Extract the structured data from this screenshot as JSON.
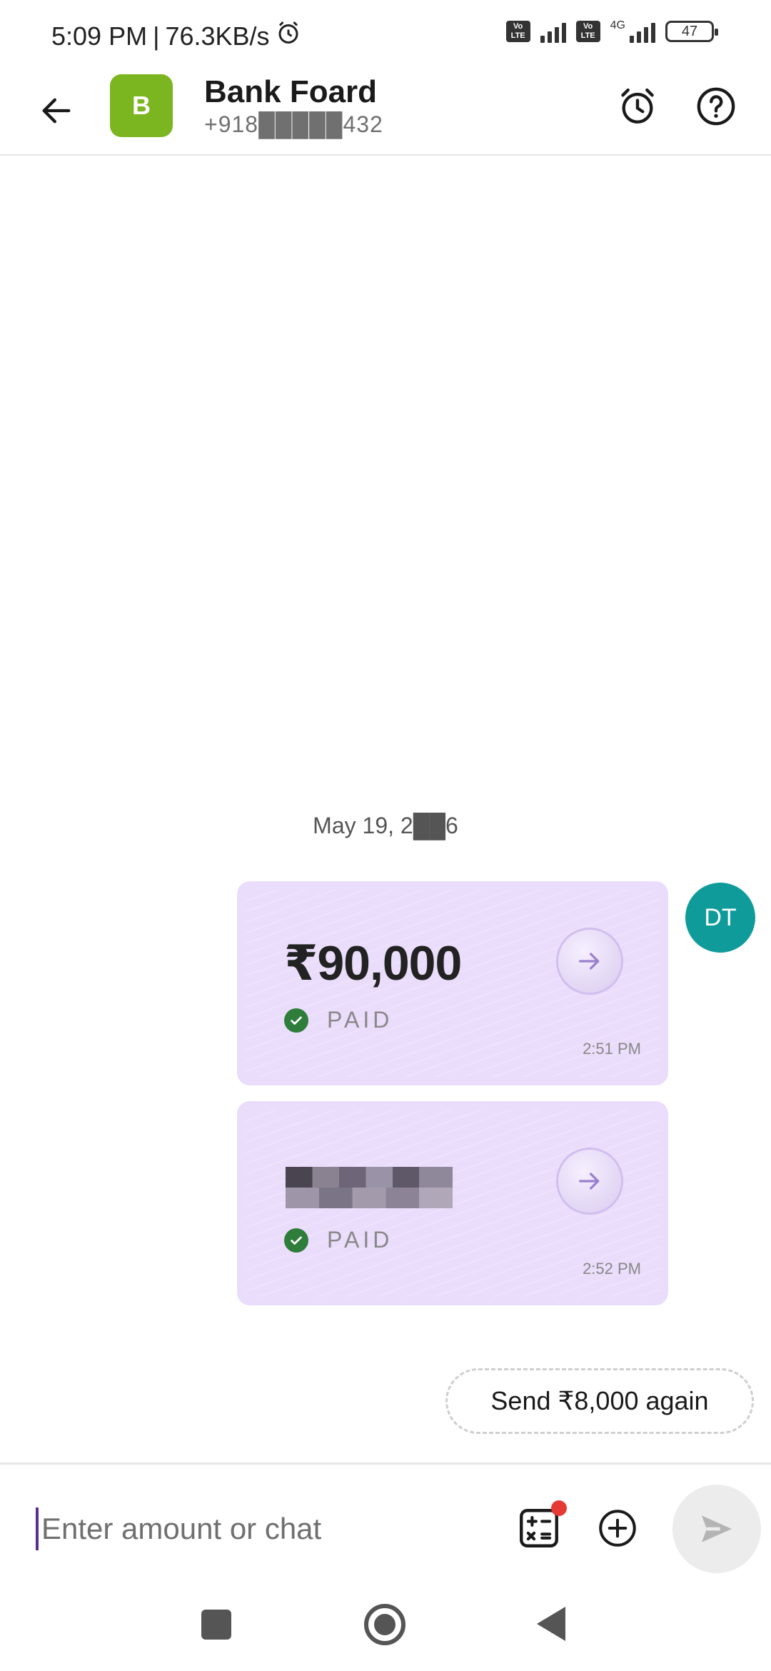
{
  "status_bar": {
    "time": "5:09 PM",
    "separator": "|",
    "net_speed": "76.3KB/s",
    "sim1_badge": "Vo LTE",
    "sim2_badge": "Vo LTE",
    "network_type": "4G",
    "battery": "47"
  },
  "header": {
    "avatar_letter": "B",
    "contact_name": "Bank Foard",
    "contact_phone": "+918█████432",
    "icons": [
      "back-arrow-icon",
      "alarm-clock-icon",
      "help-icon"
    ]
  },
  "chat": {
    "date_separator": "May 19, 2██6",
    "sender_avatar": "DT",
    "payments": [
      {
        "amount": "₹90,000",
        "status": "PAID",
        "time": "2:51 PM"
      },
      {
        "amount": "",
        "status": "PAID",
        "time": "2:52 PM"
      }
    ],
    "send_again_label": "Send ₹8,000 again"
  },
  "composer": {
    "placeholder": "Enter amount or chat",
    "icons": [
      "calculator-icon",
      "add-circle-icon",
      "send-icon"
    ]
  },
  "colors": {
    "brand_purple": "#5b2d91",
    "avatar_green": "#7bb51f",
    "avatar_teal": "#109b9b",
    "card_lilac": "#eadcfb",
    "paid_green": "#2f7d3a"
  }
}
